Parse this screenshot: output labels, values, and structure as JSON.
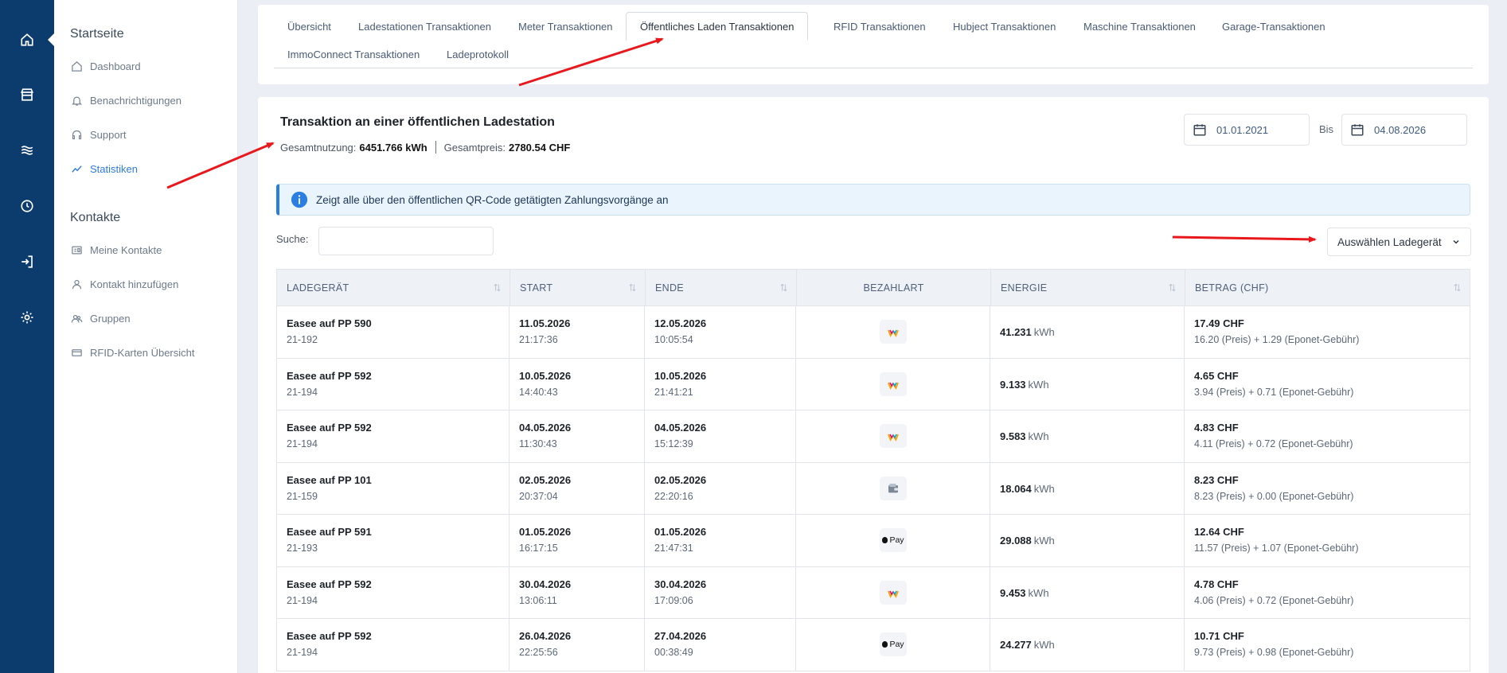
{
  "rail": {
    "icons": [
      "home-icon",
      "store-icon",
      "waves-icon",
      "clock-icon",
      "login-icon",
      "gear-icon"
    ]
  },
  "sidebar": {
    "section1_title": "Startseite",
    "section1_items": [
      {
        "label": "Dashboard",
        "icon": "home-outline-icon"
      },
      {
        "label": "Benachrichtigungen",
        "icon": "bell-icon"
      },
      {
        "label": "Support",
        "icon": "headset-icon"
      },
      {
        "label": "Statistiken",
        "icon": "chart-line-icon"
      }
    ],
    "section2_title": "Kontakte",
    "section2_items": [
      {
        "label": "Meine Kontakte",
        "icon": "contact-card-icon"
      },
      {
        "label": "Kontakt hinzufügen",
        "icon": "user-icon"
      },
      {
        "label": "Gruppen",
        "icon": "group-icon"
      },
      {
        "label": "RFID-Karten Übersicht",
        "icon": "card-icon"
      }
    ]
  },
  "tabs": [
    {
      "label": "Übersicht"
    },
    {
      "label": "Ladestationen Transaktionen"
    },
    {
      "label": "Meter Transaktionen"
    },
    {
      "label": "Öffentliches Laden Transaktionen"
    },
    {
      "label": "RFID Transaktionen"
    },
    {
      "label": "Hubject Transaktionen"
    },
    {
      "label": "Maschine Transaktionen"
    },
    {
      "label": "Garage-Transaktionen"
    },
    {
      "label": "ImmoConnect Transaktionen"
    },
    {
      "label": "Ladeprotokoll"
    }
  ],
  "main": {
    "title": "Transaktion an einer öffentlichen Ladestation",
    "usage_label": "Gesamtnutzung:",
    "usage_value": "6451.766 kWh",
    "price_label": "Gesamtpreis:",
    "price_value": "2780.54 CHF",
    "date_from": "01.01.2021",
    "bis_label": "Bis",
    "date_to": "04.08.2026",
    "info_text": "Zeigt alle über den öffentlichen QR-Code getätigten Zahlungsvorgänge an",
    "search_label": "Suche:",
    "search_value": "",
    "select_label": "Auswählen Ladegerät"
  },
  "table": {
    "headers": [
      "LADEGERÄT",
      "START",
      "ENDE",
      "BEZAHLART",
      "ENERGIE",
      "BETRAG (CHF)"
    ],
    "energy_unit": "kWh",
    "rows": [
      {
        "device": "Easee auf PP 590",
        "device_id": "21-192",
        "start_date": "11.05.2026",
        "start_time": "21:17:36",
        "end_date": "12.05.2026",
        "end_time": "10:05:54",
        "payment": "twint",
        "energy": "41.231",
        "amount": "17.49 CHF",
        "detail": "16.20 (Preis)  +  1.29 (Eponet-Gebühr)"
      },
      {
        "device": "Easee auf PP 592",
        "device_id": "21-194",
        "start_date": "10.05.2026",
        "start_time": "14:40:43",
        "end_date": "10.05.2026",
        "end_time": "21:41:21",
        "payment": "twint",
        "energy": "9.133",
        "amount": "4.65 CHF",
        "detail": "3.94 (Preis)  +  0.71 (Eponet-Gebühr)"
      },
      {
        "device": "Easee auf PP 592",
        "device_id": "21-194",
        "start_date": "04.05.2026",
        "start_time": "11:30:43",
        "end_date": "04.05.2026",
        "end_time": "15:12:39",
        "payment": "twint",
        "energy": "9.583",
        "amount": "4.83 CHF",
        "detail": "4.11 (Preis)  +  0.72 (Eponet-Gebühr)"
      },
      {
        "device": "Easee auf PP 101",
        "device_id": "21-159",
        "start_date": "02.05.2026",
        "start_time": "20:37:04",
        "end_date": "02.05.2026",
        "end_time": "22:20:16",
        "payment": "wallet",
        "energy": "18.064",
        "amount": "8.23 CHF",
        "detail": "8.23 (Preis)  +  0.00 (Eponet-Gebühr)"
      },
      {
        "device": "Easee auf PP 591",
        "device_id": "21-193",
        "start_date": "01.05.2026",
        "start_time": "16:17:15",
        "end_date": "01.05.2026",
        "end_time": "21:47:31",
        "payment": "applepay",
        "energy": "29.088",
        "amount": "12.64 CHF",
        "detail": "11.57 (Preis)  +  1.07 (Eponet-Gebühr)"
      },
      {
        "device": "Easee auf PP 592",
        "device_id": "21-194",
        "start_date": "30.04.2026",
        "start_time": "13:06:11",
        "end_date": "30.04.2026",
        "end_time": "17:09:06",
        "payment": "twint",
        "energy": "9.453",
        "amount": "4.78 CHF",
        "detail": "4.06 (Preis)  +  0.72 (Eponet-Gebühr)"
      },
      {
        "device": "Easee auf PP 592",
        "device_id": "21-194",
        "start_date": "26.04.2026",
        "start_time": "22:25:56",
        "end_date": "27.04.2026",
        "end_time": "00:38:49",
        "payment": "applepay",
        "energy": "24.277",
        "amount": "10.71 CHF",
        "detail": "9.73 (Preis)  +  0.98 (Eponet-Gebühr)"
      }
    ]
  },
  "apple_pay_label": "Pay",
  "colors": {
    "rail": "#0c3b6e",
    "accent": "#2e7be0",
    "annotation_arrow": "#e8181c"
  }
}
